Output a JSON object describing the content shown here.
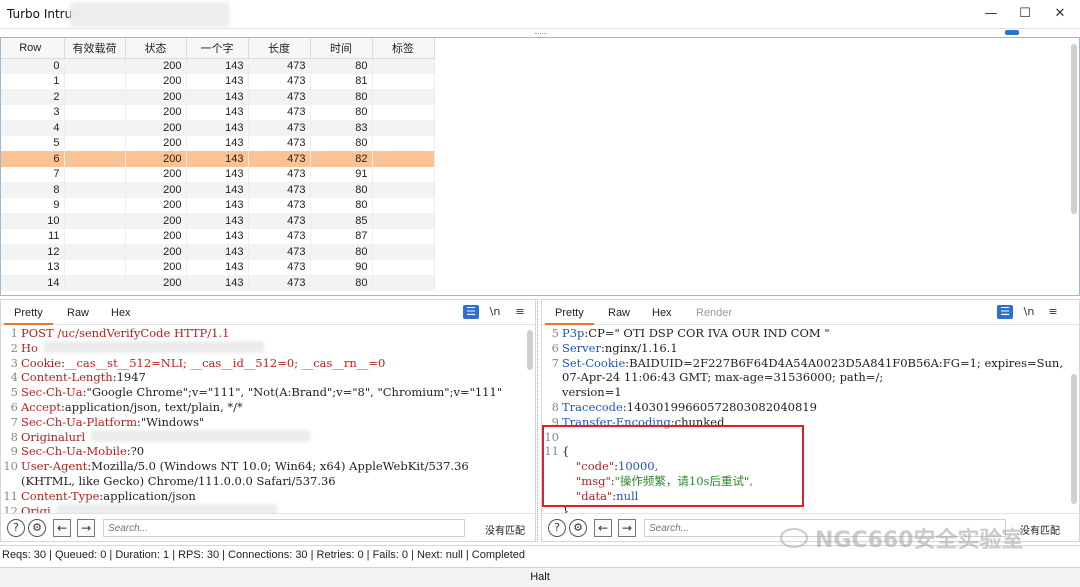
{
  "window": {
    "title": "Turbo Intrude",
    "controls": {
      "minimize": "—",
      "maximize": "☐",
      "close": "✕"
    }
  },
  "results": {
    "columns": [
      "Row",
      "有效载荷",
      "状态",
      "一个字",
      "长度",
      "时间",
      "标签"
    ],
    "selected_row": 6,
    "rows": [
      [
        "0",
        "",
        "200",
        "143",
        "473",
        "80",
        ""
      ],
      [
        "1",
        "",
        "200",
        "143",
        "473",
        "81",
        ""
      ],
      [
        "2",
        "",
        "200",
        "143",
        "473",
        "80",
        ""
      ],
      [
        "3",
        "",
        "200",
        "143",
        "473",
        "80",
        ""
      ],
      [
        "4",
        "",
        "200",
        "143",
        "473",
        "83",
        ""
      ],
      [
        "5",
        "",
        "200",
        "143",
        "473",
        "80",
        ""
      ],
      [
        "6",
        "",
        "200",
        "143",
        "473",
        "82",
        ""
      ],
      [
        "7",
        "",
        "200",
        "143",
        "473",
        "91",
        ""
      ],
      [
        "8",
        "",
        "200",
        "143",
        "473",
        "80",
        ""
      ],
      [
        "9",
        "",
        "200",
        "143",
        "473",
        "80",
        ""
      ],
      [
        "10",
        "",
        "200",
        "143",
        "473",
        "85",
        ""
      ],
      [
        "11",
        "",
        "200",
        "143",
        "473",
        "87",
        ""
      ],
      [
        "12",
        "",
        "200",
        "143",
        "473",
        "80",
        ""
      ],
      [
        "13",
        "",
        "200",
        "143",
        "473",
        "90",
        ""
      ],
      [
        "14",
        "",
        "200",
        "143",
        "473",
        "80",
        ""
      ]
    ]
  },
  "request_pane": {
    "tabs": [
      "Pretty",
      "Raw",
      "Hex"
    ],
    "active_tab": "Pretty",
    "newline_toggle": "\\n",
    "menu": "≡",
    "lines": [
      {
        "n": "1",
        "key": "POST /uc/sendVerifyCode HTTP/1.1",
        "sep": "",
        "val": ""
      },
      {
        "n": "2",
        "key": "Ho",
        "sep": "",
        "val": ""
      },
      {
        "n": "3",
        "key": "Cookie",
        "sep": ": ",
        "val": "__cas__st__512=NLI; __cas__id__512=0; __cas__rn__=0"
      },
      {
        "n": "4",
        "key": "Content-Length",
        "sep": ": ",
        "val": "1947"
      },
      {
        "n": "5",
        "key": "Sec-Ch-Ua",
        "sep": ": ",
        "val": "\"Google Chrome\";v=\"111\", \"Not(A:Brand\";v=\"8\", \"Chromium\";v=\"111\""
      },
      {
        "n": "6",
        "key": "Accept",
        "sep": ": ",
        "val": "application/json, text/plain, */*"
      },
      {
        "n": "7",
        "key": "Sec-Ch-Ua-Platform",
        "sep": ": ",
        "val": "\"Windows\""
      },
      {
        "n": "8",
        "key": "Originalurl",
        "sep": "",
        "val": ""
      },
      {
        "n": "9",
        "key": "Sec-Ch-Ua-Mobile",
        "sep": ": ",
        "val": "?0"
      },
      {
        "n": "10",
        "key": "User-Agent",
        "sep": ": ",
        "val": "Mozilla/5.0 (Windows NT 10.0; Win64; x64) AppleWebKit/537.36"
      },
      {
        "n": "",
        "key": "",
        "sep": "",
        "val": "(KHTML, like Gecko) Chrome/111.0.0.0 Safari/537.36"
      },
      {
        "n": "11",
        "key": "Content-Type",
        "sep": ": ",
        "val": "application/json"
      },
      {
        "n": "12",
        "key": "Origi",
        "sep": "",
        "val": ""
      }
    ],
    "search_placeholder": "Search...",
    "no_match": "没有匹配"
  },
  "response_pane": {
    "tabs": [
      "Pretty",
      "Raw",
      "Hex",
      "Render"
    ],
    "active_tab": "Pretty",
    "newline_toggle": "\\n",
    "menu": "≡",
    "lines": [
      {
        "n": "5",
        "key": "P3p",
        "sep": ": ",
        "val": "CP=\" OTI DSP COR IVA OUR IND COM \""
      },
      {
        "n": "6",
        "key": "Server",
        "sep": ": ",
        "val": "nginx/1.16.1"
      },
      {
        "n": "7",
        "key": "Set-Cookie",
        "sep": ": ",
        "val": "BAIDUID=2F227B6F64D4A54A0023D5A841F0B56A:FG=1; expires=Sun,"
      },
      {
        "n": "",
        "key": "",
        "sep": "",
        "val": "07-Apr-24 11:06:43 GMT; max-age=31536000; path=/;"
      },
      {
        "n": "",
        "key": "",
        "sep": "",
        "val": "version=1"
      },
      {
        "n": "8",
        "key": "Tracecode",
        "sep": ": ",
        "val": "14030199660572803082040819"
      },
      {
        "n": "9",
        "key": "Transfer-Encoding",
        "sep": ": ",
        "val": "chunked"
      },
      {
        "n": "10",
        "key": "",
        "sep": "",
        "val": ""
      },
      {
        "n": "11",
        "key": "",
        "sep": "",
        "val": "{"
      }
    ],
    "json_body": [
      {
        "k": "\"code\"",
        "v": "10000,"
      },
      {
        "k": "\"msg\"",
        "v": "\"操作频繁，请10s后重试\","
      },
      {
        "k": "\"data\"",
        "v": "null"
      }
    ],
    "close_brace": "}",
    "search_placeholder": "Search...",
    "no_match": "没有匹配"
  },
  "status_bar": "Reqs: 30 | Queued: 0 | Duration: 1 | RPS: 30 | Connections: 30 | Retries: 0 | Fails: 0 | Next: null | Completed",
  "halt_button": "Halt",
  "watermark": "NGC660安全实验室",
  "colors": {
    "selected_row": "#fbc293",
    "accent_tab": "#e8762c",
    "highlight_box": "#e0202a",
    "header_key": "#b02020"
  }
}
